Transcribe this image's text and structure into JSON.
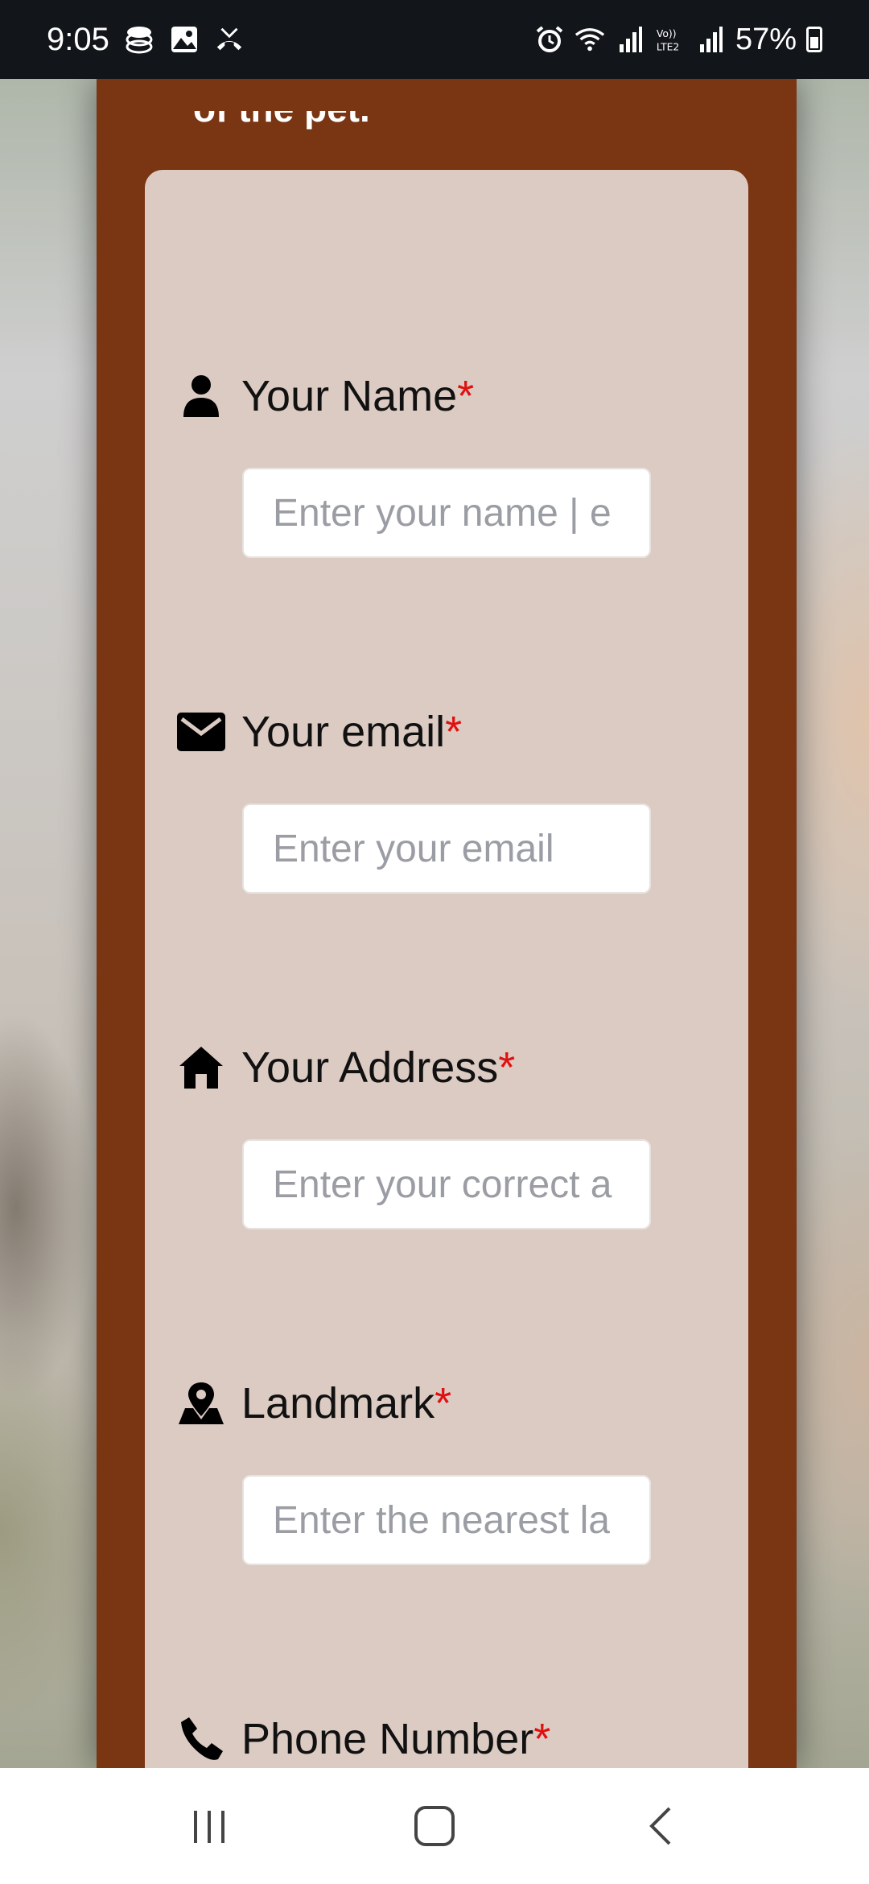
{
  "status_bar": {
    "time": "9:05",
    "battery": "57%",
    "icons": [
      "app-notification-icon",
      "gallery-icon",
      "missed-call-icon",
      "alarm-icon",
      "wifi-icon",
      "signal-icon",
      "volte-icon",
      "signal-icon-2",
      "battery-icon"
    ]
  },
  "page": {
    "heading": "of the pet."
  },
  "form": {
    "name": {
      "label": "Your Name",
      "required": "*",
      "placeholder": "Enter your name | e",
      "icon": "person-icon"
    },
    "email": {
      "label": "Your email",
      "required": "*",
      "placeholder": "Enter your email",
      "icon": "mail-icon"
    },
    "address": {
      "label": "Your Address",
      "required": "*",
      "placeholder": "Enter your correct a",
      "icon": "home-icon"
    },
    "landmark": {
      "label": "Landmark",
      "required": "*",
      "placeholder": "Enter the nearest la",
      "icon": "map-pin-icon"
    },
    "phone": {
      "label": "Phone Number",
      "required": "*",
      "icon": "phone-icon"
    }
  },
  "nav_bar": {
    "buttons": [
      "recent-apps-icon",
      "home-button-icon",
      "back-icon"
    ]
  },
  "colors": {
    "panel": "#7a3512",
    "card": "#dccbc3",
    "required": "#e01010",
    "status_bar": "#12151a"
  }
}
